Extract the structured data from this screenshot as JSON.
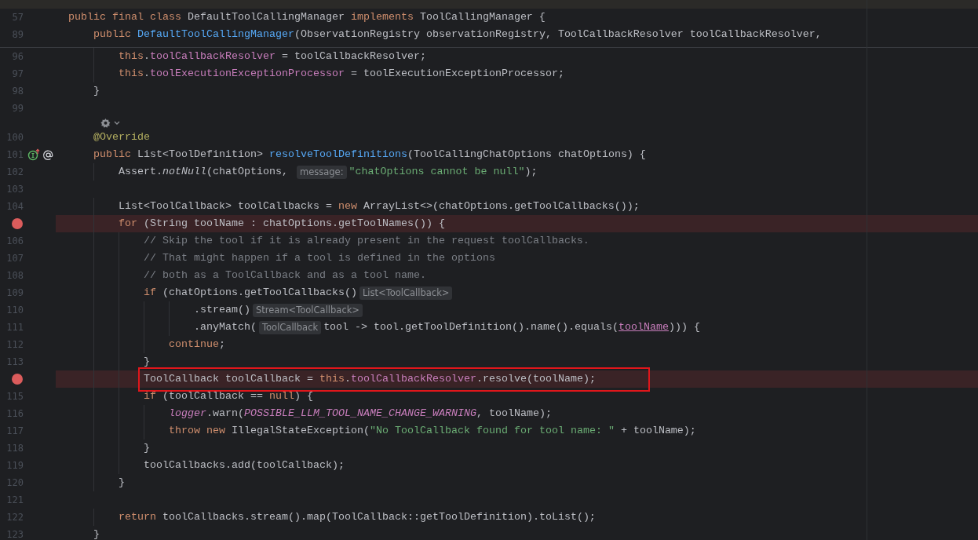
{
  "sticky_lines": [
    {
      "number": "57",
      "tokens": [
        {
          "kind": "keyword",
          "text": "public final class"
        },
        {
          "kind": "plain",
          "text": " DefaultToolCallingManager "
        },
        {
          "kind": "keyword",
          "text": "implements"
        },
        {
          "kind": "plain",
          "text": " ToolCallingManager {"
        }
      ]
    },
    {
      "number": "89",
      "tokens": [
        {
          "kind": "keyword",
          "text": "    public"
        },
        {
          "kind": "method",
          "text": " DefaultToolCallingManager"
        },
        {
          "kind": "plain",
          "text": "(ObservationRegistry observationRegistry, ToolCallbackResolver toolCallbackResolver,"
        }
      ]
    }
  ],
  "lines": [
    {
      "kind": "code",
      "number": "96",
      "breakpoint": false,
      "tokens": [
        {
          "kind": "keyword",
          "text": "        this"
        },
        {
          "kind": "plain",
          "text": "."
        },
        {
          "kind": "field",
          "text": "toolCallbackResolver"
        },
        {
          "kind": "plain",
          "text": " = toolCallbackResolver;"
        }
      ]
    },
    {
      "kind": "code",
      "number": "97",
      "breakpoint": false,
      "tokens": [
        {
          "kind": "keyword",
          "text": "        this"
        },
        {
          "kind": "plain",
          "text": "."
        },
        {
          "kind": "field",
          "text": "toolExecutionExceptionProcessor"
        },
        {
          "kind": "plain",
          "text": " = toolExecutionExceptionProcessor;"
        }
      ]
    },
    {
      "kind": "code",
      "number": "98",
      "breakpoint": false,
      "tokens": [
        {
          "kind": "plain",
          "text": "    }"
        }
      ]
    },
    {
      "kind": "code",
      "number": "99",
      "breakpoint": false
    },
    {
      "kind": "widget"
    },
    {
      "kind": "code",
      "number": "100",
      "breakpoint": false,
      "tokens": [
        {
          "kind": "annotation",
          "text": "    @Override"
        }
      ]
    },
    {
      "kind": "code",
      "number": "101",
      "breakpoint": false,
      "markers": [
        {
          "kind": "implements"
        },
        {
          "kind": "at"
        }
      ],
      "tokens": [
        {
          "kind": "keyword",
          "text": "    public"
        },
        {
          "kind": "plain",
          "text": " List<ToolDefinition> "
        },
        {
          "kind": "method",
          "text": "resolveToolDefinitions"
        },
        {
          "kind": "plain",
          "text": "(ToolCallingChatOptions chatOptions) {"
        }
      ]
    },
    {
      "kind": "code",
      "number": "102",
      "breakpoint": false,
      "tokens": [
        {
          "kind": "plain",
          "text": "        Assert."
        },
        {
          "kind": "static",
          "text": "notNull"
        },
        {
          "kind": "plain",
          "text": "(chatOptions, "
        },
        {
          "kind": "hint",
          "text": "message:"
        },
        {
          "kind": "string",
          "text": "\"chatOptions cannot be null\""
        },
        {
          "kind": "plain",
          "text": ");"
        }
      ]
    },
    {
      "kind": "code",
      "number": "103",
      "breakpoint": false
    },
    {
      "kind": "code",
      "number": "104",
      "breakpoint": false,
      "tokens": [
        {
          "kind": "plain",
          "text": "        List<ToolCallback> toolCallbacks = "
        },
        {
          "kind": "keyword",
          "text": "new"
        },
        {
          "kind": "plain",
          "text": " ArrayList<>(chatOptions.getToolCallbacks());"
        }
      ]
    },
    {
      "kind": "code",
      "breakpoint": true,
      "tokens": [
        {
          "kind": "keyword",
          "text": "        for"
        },
        {
          "kind": "plain",
          "text": " (String toolName : chatOptions.getToolNames()) {"
        }
      ]
    },
    {
      "kind": "code",
      "number": "106",
      "breakpoint": false,
      "tokens": [
        {
          "kind": "comment",
          "text": "            // Skip the tool if it is already present in the request toolCallbacks."
        }
      ]
    },
    {
      "kind": "code",
      "number": "107",
      "breakpoint": false,
      "tokens": [
        {
          "kind": "comment",
          "text": "            // That might happen if a tool is defined in the options"
        }
      ]
    },
    {
      "kind": "code",
      "number": "108",
      "breakpoint": false,
      "tokens": [
        {
          "kind": "comment",
          "text": "            // both as a ToolCallback and as a tool name."
        }
      ]
    },
    {
      "kind": "code",
      "number": "109",
      "breakpoint": false,
      "tokens": [
        {
          "kind": "keyword",
          "text": "            if"
        },
        {
          "kind": "plain",
          "text": " (chatOptions.getToolCallbacks()"
        },
        {
          "kind": "hint",
          "text": "List<ToolCallback>"
        }
      ]
    },
    {
      "kind": "code",
      "number": "110",
      "breakpoint": false,
      "tokens": [
        {
          "kind": "plain",
          "text": "                    .stream()"
        },
        {
          "kind": "hint",
          "text": "Stream<ToolCallback>"
        }
      ]
    },
    {
      "kind": "code",
      "number": "111",
      "breakpoint": false,
      "tokens": [
        {
          "kind": "plain",
          "text": "                    .anyMatch("
        },
        {
          "kind": "hint",
          "text": "ToolCallback"
        },
        {
          "kind": "plain",
          "text": "tool -> tool.getToolDefinition().name().equals("
        },
        {
          "kind": "captured",
          "text": "toolName"
        },
        {
          "kind": "plain",
          "text": "))) {"
        }
      ]
    },
    {
      "kind": "code",
      "number": "112",
      "breakpoint": false,
      "tokens": [
        {
          "kind": "keyword",
          "text": "                continue"
        },
        {
          "kind": "plain",
          "text": ";"
        }
      ]
    },
    {
      "kind": "code",
      "number": "113",
      "breakpoint": false,
      "tokens": [
        {
          "kind": "plain",
          "text": "            }"
        }
      ]
    },
    {
      "kind": "code",
      "breakpoint": true,
      "boxed": true,
      "tokens": [
        {
          "kind": "plain",
          "text": "            ToolCallback toolCallback = "
        },
        {
          "kind": "keyword",
          "text": "this"
        },
        {
          "kind": "plain",
          "text": "."
        },
        {
          "kind": "field",
          "text": "toolCallbackResolver"
        },
        {
          "kind": "plain",
          "text": ".resolve(toolName);"
        }
      ]
    },
    {
      "kind": "code",
      "number": "115",
      "breakpoint": false,
      "tokens": [
        {
          "kind": "keyword",
          "text": "            if"
        },
        {
          "kind": "plain",
          "text": " (toolCallback == "
        },
        {
          "kind": "keyword",
          "text": "null"
        },
        {
          "kind": "plain",
          "text": ") {"
        }
      ]
    },
    {
      "kind": "code",
      "number": "116",
      "breakpoint": false,
      "tokens": [
        {
          "kind": "static_field",
          "text": "                logger"
        },
        {
          "kind": "plain",
          "text": ".warn("
        },
        {
          "kind": "static_field",
          "text": "POSSIBLE_LLM_TOOL_NAME_CHANGE_WARNING"
        },
        {
          "kind": "plain",
          "text": ", toolName);"
        }
      ]
    },
    {
      "kind": "code",
      "number": "117",
      "breakpoint": false,
      "tokens": [
        {
          "kind": "keyword",
          "text": "                throw new"
        },
        {
          "kind": "plain",
          "text": " IllegalStateException("
        },
        {
          "kind": "string",
          "text": "\"No ToolCallback found for tool name: \""
        },
        {
          "kind": "plain",
          "text": " + toolName);"
        }
      ]
    },
    {
      "kind": "code",
      "number": "118",
      "breakpoint": false,
      "tokens": [
        {
          "kind": "plain",
          "text": "            }"
        }
      ]
    },
    {
      "kind": "code",
      "number": "119",
      "breakpoint": false,
      "tokens": [
        {
          "kind": "plain",
          "text": "            toolCallbacks.add(toolCallback);"
        }
      ]
    },
    {
      "kind": "code",
      "number": "120",
      "breakpoint": false,
      "tokens": [
        {
          "kind": "plain",
          "text": "        }"
        }
      ]
    },
    {
      "kind": "code",
      "number": "121",
      "breakpoint": false
    },
    {
      "kind": "code",
      "number": "122",
      "breakpoint": false,
      "tokens": [
        {
          "kind": "keyword",
          "text": "        return"
        },
        {
          "kind": "plain",
          "text": " toolCallbacks.stream().map(ToolCallback::getToolDefinition).toList();"
        }
      ]
    },
    {
      "kind": "code",
      "number": "123",
      "breakpoint": false,
      "tokens": [
        {
          "kind": "plain",
          "text": "    }"
        }
      ]
    }
  ]
}
